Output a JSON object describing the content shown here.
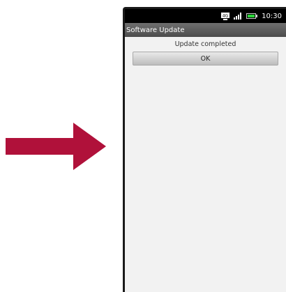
{
  "status_bar": {
    "time": "10:30",
    "icons": [
      "4g-icon",
      "signal-icon",
      "battery-icon"
    ]
  },
  "title_bar": {
    "title": "Software Update"
  },
  "dialog": {
    "message": "Update completed",
    "ok_label": "OK"
  },
  "colors": {
    "arrow": "#b0113a",
    "status_bar_bg": "#000000",
    "title_bar_bg": "#5a5a5a",
    "content_bg": "#f2f2f2",
    "battery": "#2bd63a"
  }
}
